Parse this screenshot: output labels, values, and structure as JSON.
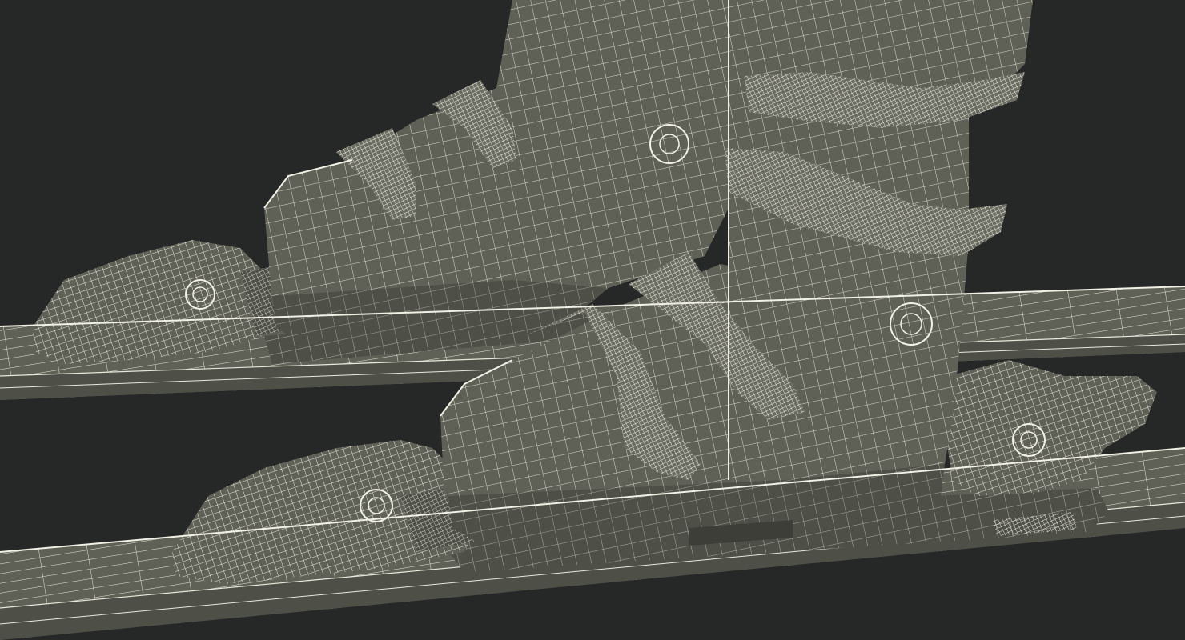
{
  "scene": {
    "subject": "wireframe-ski-boots-on-skis",
    "colors": {
      "background": "#262727",
      "surface": "#5f6056",
      "surface_dark": "#4e4f47",
      "surface_light": "#6b6c61",
      "wire": "#e9e8dc",
      "wire_dense": "#f2f1e6"
    },
    "icons": [
      "ski-icon",
      "boot-icon",
      "binding-icon",
      "buckle-icon"
    ]
  }
}
